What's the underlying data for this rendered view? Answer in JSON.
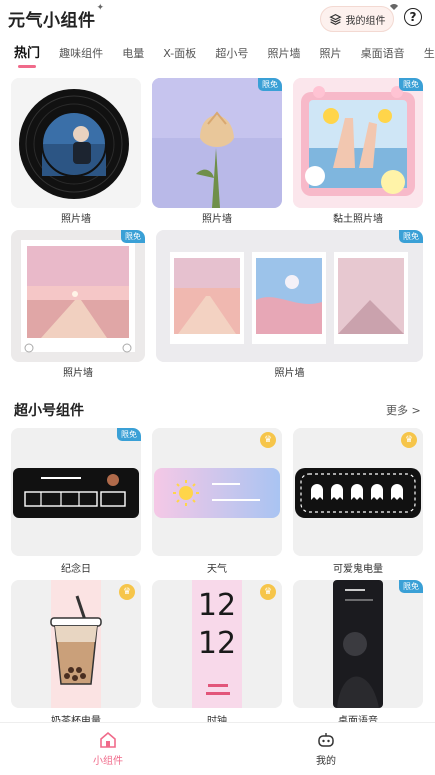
{
  "header": {
    "app_title": "元气小组件",
    "my_widget_label": "我的组件",
    "help_icon_text": "?"
  },
  "tabs": [
    {
      "label": "热门",
      "active": true
    },
    {
      "label": "趣味组件",
      "active": false
    },
    {
      "label": "电量",
      "active": false
    },
    {
      "label": "X-面板",
      "active": false
    },
    {
      "label": "超小号",
      "active": false
    },
    {
      "label": "照片墙",
      "active": false
    },
    {
      "label": "照片",
      "active": false
    },
    {
      "label": "桌面语音",
      "active": false
    },
    {
      "label": "生活助",
      "active": false
    }
  ],
  "hot": {
    "row1": [
      {
        "label": "照片墙",
        "badge": ""
      },
      {
        "label": "照片墙",
        "badge": "限免"
      },
      {
        "label": "黏土照片墙",
        "badge": "限免"
      }
    ],
    "row2": [
      {
        "label": "照片墙",
        "badge": "限免"
      },
      {
        "label": "照片墙",
        "badge": "限免"
      }
    ]
  },
  "section": {
    "title": "超小号组件",
    "more_label": "更多 >"
  },
  "mini": {
    "row1": [
      {
        "label": "纪念日",
        "badge": "限免"
      },
      {
        "label": "天气",
        "badge": "crown"
      },
      {
        "label": "可爱鬼电量",
        "badge": "crown"
      }
    ],
    "row2": [
      {
        "label": "奶茶杯电量",
        "badge": "crown"
      },
      {
        "label": "时钟",
        "badge": "crown"
      },
      {
        "label": "桌面语音",
        "badge": "限免"
      }
    ]
  },
  "clock": {
    "hour": "12",
    "minute": "12"
  },
  "bottom_nav": [
    {
      "label": "小组件",
      "active": true
    },
    {
      "label": "我的",
      "active": false
    }
  ],
  "colors": {
    "accent": "#f06a8a",
    "badge": "#3aa0d6",
    "crown": "#f6c54a"
  }
}
